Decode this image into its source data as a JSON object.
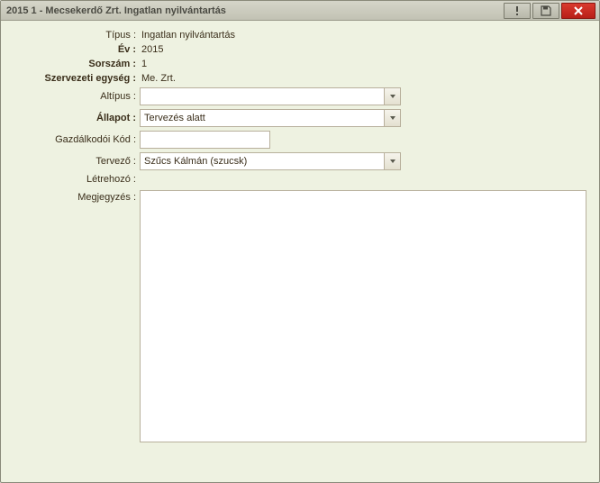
{
  "window": {
    "title": "2015 1 - Mecsekerdő Zrt. Ingatlan nyilvántartás"
  },
  "labels": {
    "tipus": "Típus :",
    "ev": "Év :",
    "sorszam": "Sorszám :",
    "szervezeti": "Szervezeti egység :",
    "altipus": "Altípus :",
    "allapot": "Állapot :",
    "gazdalkodoi": "Gazdálkodói Kód :",
    "tervezo": "Tervező :",
    "letrehozo": "Létrehozó :",
    "megjegyzes": "Megjegyzés :"
  },
  "values": {
    "tipus": "Ingatlan nyilvántartás",
    "ev": "2015",
    "sorszam": "1",
    "szervezeti": "Me. Zrt.",
    "altipus": "",
    "allapot": "Tervezés alatt",
    "gazdalkodoi": "",
    "tervezo": "Szűcs Kálmán (szucsk)",
    "letrehozo": "",
    "megjegyzes": ""
  }
}
